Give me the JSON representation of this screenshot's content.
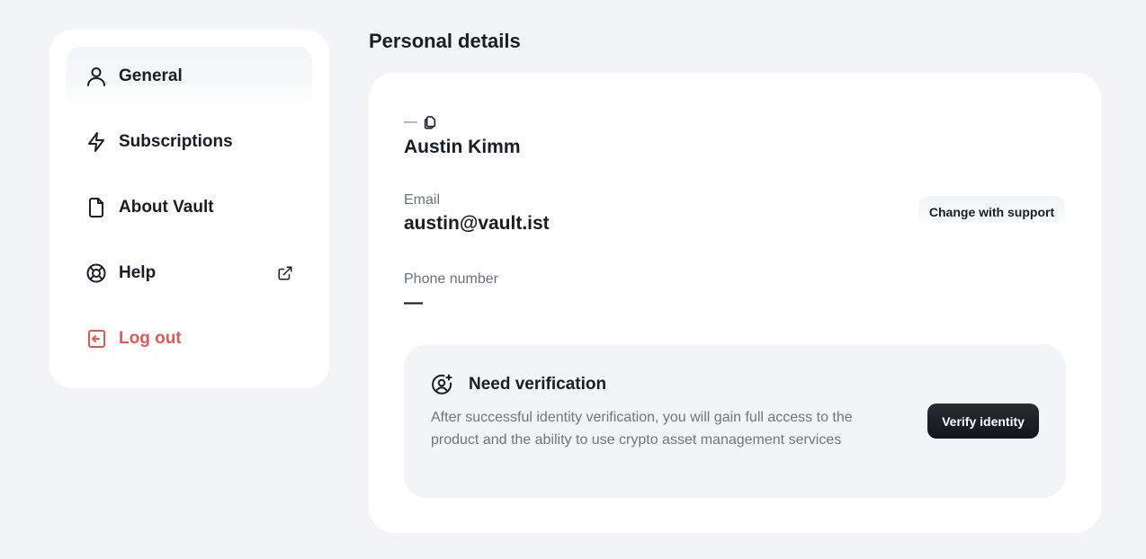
{
  "sidebar": {
    "items": [
      {
        "label": "General",
        "icon": "user-icon"
      },
      {
        "label": "Subscriptions",
        "icon": "lightning-icon"
      },
      {
        "label": "About Vault",
        "icon": "document-icon"
      },
      {
        "label": "Help",
        "icon": "lifebuoy-icon"
      },
      {
        "label": "Log out",
        "icon": "logout-icon"
      }
    ],
    "active": "General"
  },
  "page": {
    "title": "Personal details"
  },
  "details": {
    "name_meta": "—",
    "name": "Austin Kimm",
    "email_label": "Email",
    "email": "austin@vault.ist",
    "change_button": "Change with support",
    "phone_label": "Phone number",
    "phone": "—"
  },
  "verification": {
    "title": "Need verification",
    "description": "After successful identity verification, you will gain full access to the product and the ability to use crypto asset management services",
    "button": "Verify identity"
  },
  "colors": {
    "background": "#f3f4f6",
    "logout": "#e05a55",
    "primary_button": "#1c1d22"
  }
}
